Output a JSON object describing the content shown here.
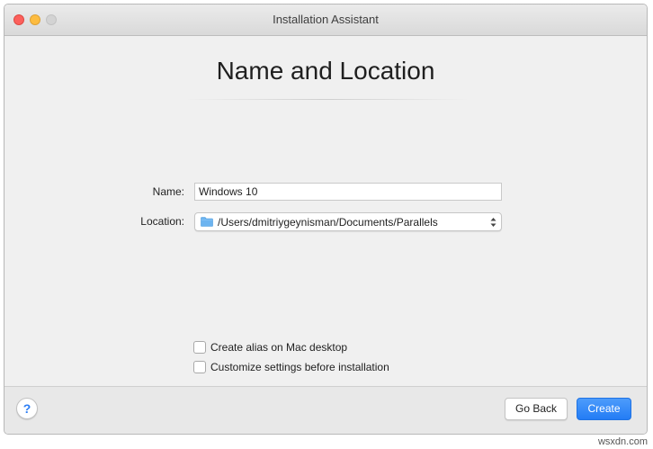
{
  "window": {
    "title": "Installation Assistant"
  },
  "page": {
    "heading": "Name and Location"
  },
  "form": {
    "name_label": "Name:",
    "name_value": "Windows 10",
    "location_label": "Location:",
    "location_value": "/Users/dmitriygeynisman/Documents/Parallels"
  },
  "options": [
    {
      "label": "Create alias on Mac desktop",
      "checked": false
    },
    {
      "label": "Customize settings before installation",
      "checked": false
    }
  ],
  "footer": {
    "help_label": "?",
    "back_label": "Go Back",
    "create_label": "Create"
  },
  "watermark": "wsxdn.com",
  "colors": {
    "accent": "#237cf5",
    "close": "#fc605c",
    "minimize": "#fdbc40",
    "zoom_disabled": "#d3d3d3",
    "folder": "#6cb4f0"
  },
  "icons": {
    "folder": "folder-icon",
    "popup": "updown-chevron-icon",
    "help": "question-mark-icon"
  }
}
